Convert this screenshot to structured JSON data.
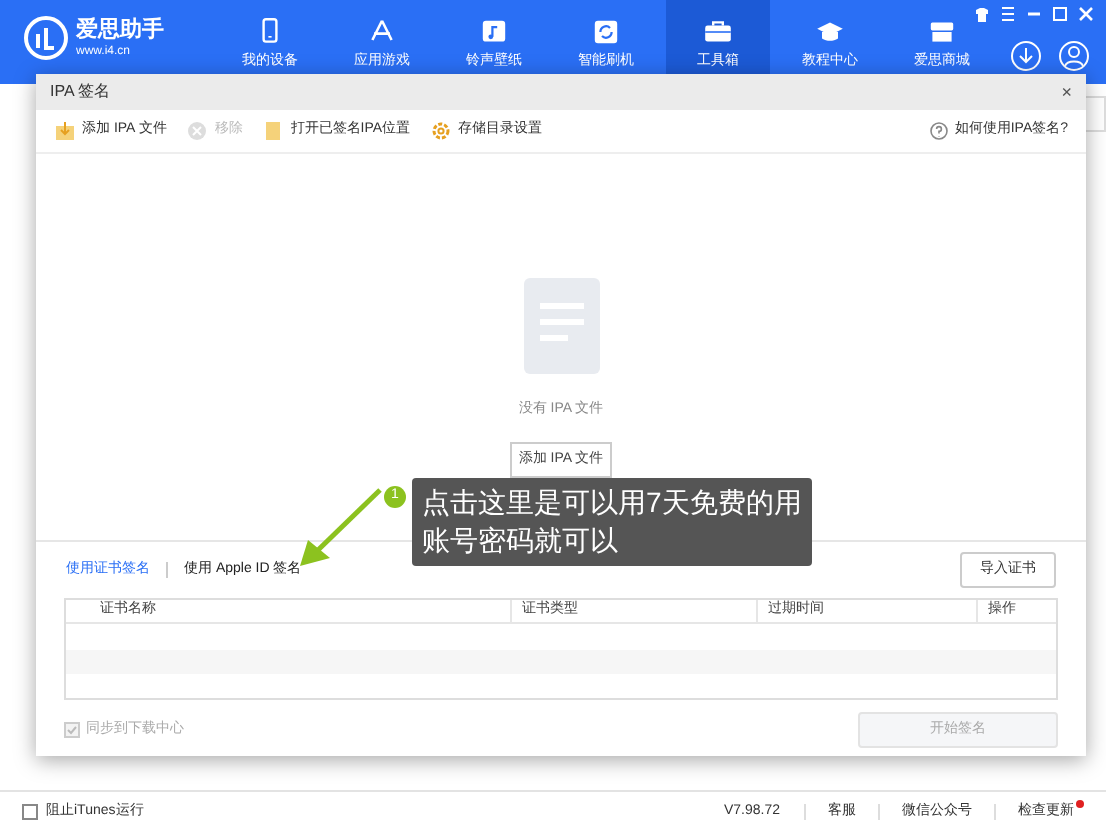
{
  "app": {
    "name": "爱思助手",
    "url": "www.i4.cn"
  },
  "nav": [
    {
      "label": "我的设备",
      "selected": false
    },
    {
      "label": "应用游戏",
      "selected": false
    },
    {
      "label": "铃声壁纸",
      "selected": false
    },
    {
      "label": "智能刷机",
      "selected": false
    },
    {
      "label": "工具箱",
      "selected": true
    },
    {
      "label": "教程中心",
      "selected": false
    },
    {
      "label": "爱思商城",
      "selected": false
    }
  ],
  "dialog": {
    "title": "IPA 签名",
    "close": "×",
    "toolbar": [
      {
        "label": "添加 IPA 文件",
        "disabled": false
      },
      {
        "label": "移除",
        "disabled": true
      },
      {
        "label": "打开已签名IPA位置",
        "disabled": false
      },
      {
        "label": "存储目录设置",
        "disabled": false
      }
    ],
    "help": "如何使用IPA签名?",
    "empty_text": "没有 IPA 文件",
    "empty_button": "添加 IPA 文件",
    "sign_tabs": [
      {
        "label": "使用证书签名",
        "selected": true
      },
      {
        "label": "使用 Apple ID 签名",
        "selected": false
      }
    ],
    "import_button": "导入证书",
    "columns": [
      "证书名称",
      "证书类型",
      "过期时间",
      "操作"
    ],
    "sync": {
      "label": "同步到下载中心",
      "checked": true,
      "disabled": true
    },
    "start_button": {
      "label": "开始签名",
      "disabled": true
    }
  },
  "callout": {
    "number": "1",
    "text": "点击这里是可以用7天免费的用账号密码就可以"
  },
  "status_bar": {
    "itunes": {
      "label": "阻止iTunes运行",
      "checked": false
    },
    "version": "V7.98.72",
    "links": [
      "客服",
      "微信公众号",
      "检查更新"
    ],
    "update_dot": true
  }
}
